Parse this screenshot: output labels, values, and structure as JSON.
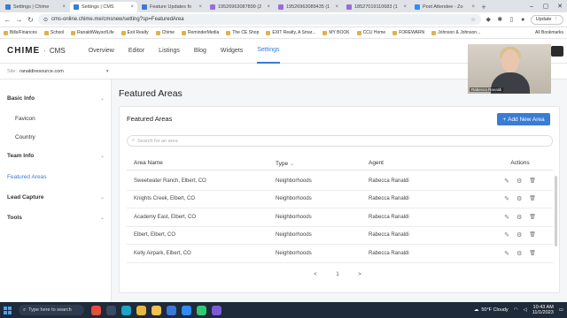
{
  "browser": {
    "tabs": [
      {
        "label": "Settings | Chime",
        "favicon_color": "#3a7bd5",
        "active": false
      },
      {
        "label": "Settings | CMS",
        "favicon_color": "#3a7bd5",
        "active": true
      },
      {
        "label": "Feature Updates fo",
        "favicon_color": "#3a7bd5",
        "active": false
      },
      {
        "label": "19526963087899 (2",
        "favicon_color": "#9c6bd6",
        "active": false
      },
      {
        "label": "19526963089435 (1",
        "favicon_color": "#9c6bd6",
        "active": false
      },
      {
        "label": "18527019110683 (1",
        "favicon_color": "#9c6bd6",
        "active": false
      },
      {
        "label": "Post Attendee - Zo",
        "favicon_color": "#2d8cff",
        "active": false
      }
    ],
    "url": "cms-online.chime.me/cmsnew/setting?sp=FeaturedArea",
    "update_label": "Update",
    "bookmarks": [
      "Bills/Finances",
      "School",
      "RanaldiWaysofLife",
      "Exit Realty",
      "Chime",
      "ReminderMedia",
      "The CE Shop",
      "EXIT Realty, A Smar...",
      "MY BOOK",
      "CCU Home",
      "FOREWARN",
      "Johnson & Johnson..."
    ],
    "all_bookmarks": "All Bookmarks"
  },
  "app": {
    "logo": "CHIME",
    "logo_suffix": "CMS",
    "nav": [
      "Overview",
      "Editor",
      "Listings",
      "Blog",
      "Widgets",
      "Settings"
    ],
    "active_nav": "Settings",
    "site_label": "Site:",
    "site_value": "ranaldiresource.com"
  },
  "video": {
    "participant": "Rabecca Ranaldi"
  },
  "sidebar": {
    "items": [
      {
        "label": "Basic Info",
        "type": "group"
      },
      {
        "label": "Favicon",
        "type": "sub"
      },
      {
        "label": "Country",
        "type": "sub"
      },
      {
        "label": "Team Info",
        "type": "group"
      },
      {
        "label": "Featured Areas",
        "type": "active"
      },
      {
        "label": "Lead Capture",
        "type": "group"
      },
      {
        "label": "Tools",
        "type": "group"
      }
    ]
  },
  "page": {
    "title": "Featured Areas",
    "card_title": "Featured Areas",
    "add_button": "Add New Area",
    "search_placeholder": "Search for an area",
    "columns": [
      "Area Name",
      "Type",
      "Agent",
      "Actions"
    ],
    "rows": [
      {
        "area": "Sweetwater Ranch, Elbert, CO",
        "type": "Neighborhoods",
        "agent": "Rabecca Ranaldi"
      },
      {
        "area": "Knights Creek, Elbert, CO",
        "type": "Neighborhoods",
        "agent": "Rabecca Ranaldi"
      },
      {
        "area": "Academy East, Elbert, CO",
        "type": "Neighborhoods",
        "agent": "Rabecca Ranaldi"
      },
      {
        "area": "Elbert, Elbert, CO",
        "type": "Neighborhoods",
        "agent": "Rabecca Ranaldi"
      },
      {
        "area": "Kelly Airpark, Elbert, CO",
        "type": "Neighborhoods",
        "agent": "Rabecca Ranaldi"
      }
    ],
    "pager": {
      "prev": "<",
      "current": "1",
      "next": ">"
    }
  },
  "taskbar": {
    "search_placeholder": "Type here to search",
    "weather": "50°F  Cloudy",
    "time": "10:43 AM",
    "date": "11/1/2023"
  }
}
